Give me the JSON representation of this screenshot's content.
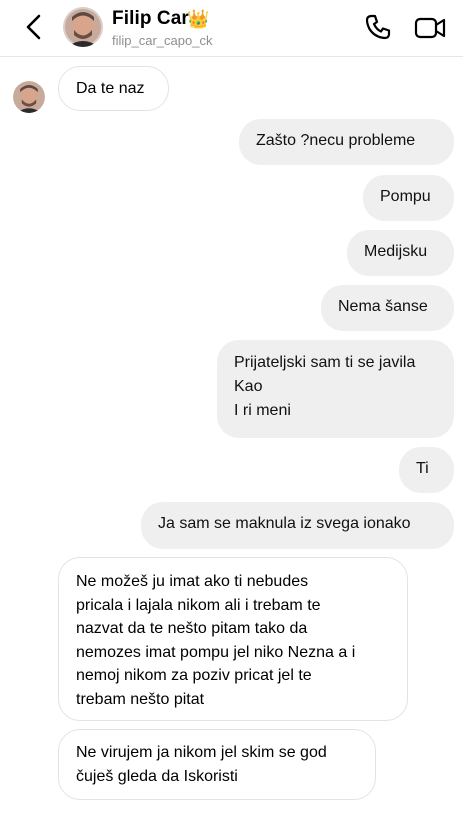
{
  "header": {
    "name": "Filip Car",
    "crown_emoji": "👑",
    "username": "filip_car_capo_ck",
    "icons": {
      "back": "chevron-left-icon",
      "call": "phone-icon",
      "video": "video-camera-icon"
    }
  },
  "messages": [
    {
      "sender": "other",
      "text": "Da te naz"
    },
    {
      "sender": "me",
      "text": "Zašto ?necu probleme"
    },
    {
      "sender": "me",
      "text": "Pompu"
    },
    {
      "sender": "me",
      "text": "Medijsku"
    },
    {
      "sender": "me",
      "text": "Nema šanse"
    },
    {
      "sender": "me",
      "text": "Prijateljski sam ti se javila\nKao\nI ri meni"
    },
    {
      "sender": "me",
      "text": "Ti"
    },
    {
      "sender": "me",
      "text": "Ja sam se maknula iz svega ionako"
    },
    {
      "sender": "other",
      "text": "Ne možeš ju imat ako ti nebudes\npricala i lajala nikom ali i trebam te\nnazvat da te nešto pitam tako da\nnemozes imat pompu jel niko Nezna a i\nnemoj nikom za poziv pricat jel te\ntrebam nešto pitat"
    },
    {
      "sender": "other",
      "text": "Ne virujem ja nikom jel skim se god\nčuješ gleda da Iskoristi"
    }
  ]
}
